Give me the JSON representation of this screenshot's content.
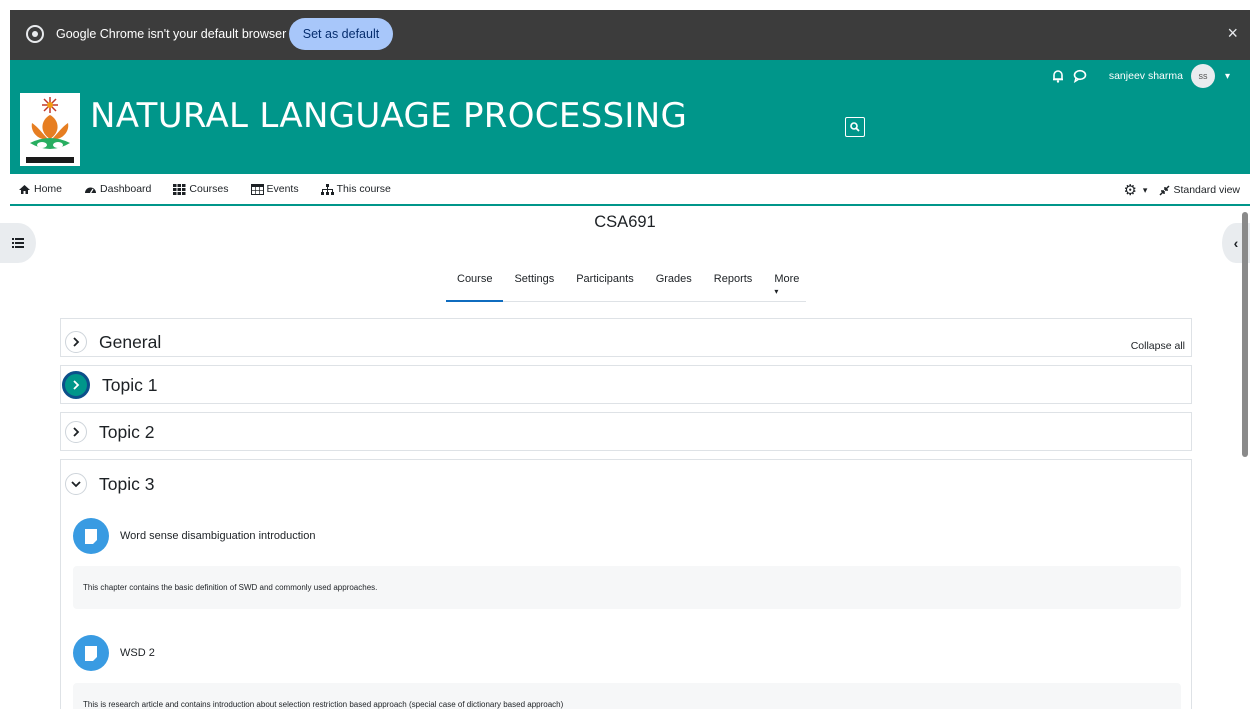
{
  "infobar": {
    "message": "Google Chrome isn't your default browser",
    "button_label": "Set as default",
    "close_glyph": "×"
  },
  "header": {
    "user_name": "sanjeev sharma",
    "avatar_initials": "ss",
    "site_title": "NATURAL LANGUAGE PROCESSING"
  },
  "nav": {
    "items": [
      {
        "label": "Home",
        "icon": "home-icon"
      },
      {
        "label": "Dashboard",
        "icon": "dashboard-icon"
      },
      {
        "label": "Courses",
        "icon": "courses-icon"
      },
      {
        "label": "Events",
        "icon": "calendar-icon"
      },
      {
        "label": "This course",
        "icon": "sitemap-icon"
      }
    ],
    "standard_view": "Standard view"
  },
  "course": {
    "code": "CSA691",
    "tabs": [
      "Course",
      "Settings",
      "Participants",
      "Grades",
      "Reports",
      "More"
    ],
    "collapse_all": "Collapse all",
    "sections": [
      "General",
      "Topic 1",
      "Topic 2",
      "Topic 3"
    ],
    "activities": [
      {
        "title": "Word sense disambiguation introduction",
        "description": "This chapter contains the basic definition of SWD and commonly used approaches."
      },
      {
        "title": "WSD 2",
        "description": "This is research article and contains introduction about selection restriction based approach (special case of  dictionary based approach)"
      }
    ]
  },
  "colors": {
    "brand": "#00968a",
    "infobar": "#3c3c3c",
    "button": "#a8c7fa",
    "activity_icon": "#399be2"
  }
}
